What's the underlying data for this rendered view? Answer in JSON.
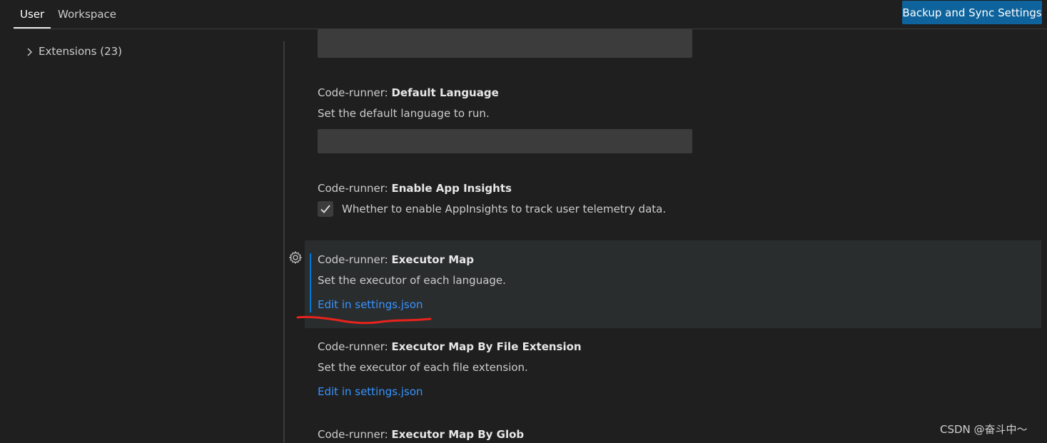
{
  "tabs": [
    {
      "label": "User",
      "active": true
    },
    {
      "label": "Workspace",
      "active": false
    }
  ],
  "header": {
    "sync_button": "Backup and Sync Settings"
  },
  "toc": {
    "items": [
      {
        "label": "Extensions (23)"
      }
    ]
  },
  "settings": [
    {
      "category": "Code-runner: ",
      "name": "Default Language",
      "description": "Set the default language to run.",
      "input_value": ""
    },
    {
      "category": "Code-runner: ",
      "name": "Enable App Insights",
      "description": "Whether to enable AppInsights to track user telemetry data.",
      "checked": true
    },
    {
      "category": "Code-runner: ",
      "name": "Executor Map",
      "description": "Set the executor of each language.",
      "link": "Edit in settings.json"
    },
    {
      "category": "Code-runner: ",
      "name": "Executor Map By File Extension",
      "description": "Set the executor of each file extension.",
      "link": "Edit in settings.json"
    },
    {
      "category": "Code-runner: ",
      "name": "Executor Map By Glob"
    }
  ],
  "watermark": "CSDN @奋斗中～",
  "colors": {
    "accent": "#0e639c",
    "link": "#3794ff",
    "annotation": "#e8231c",
    "background": "#1f1f1f"
  }
}
